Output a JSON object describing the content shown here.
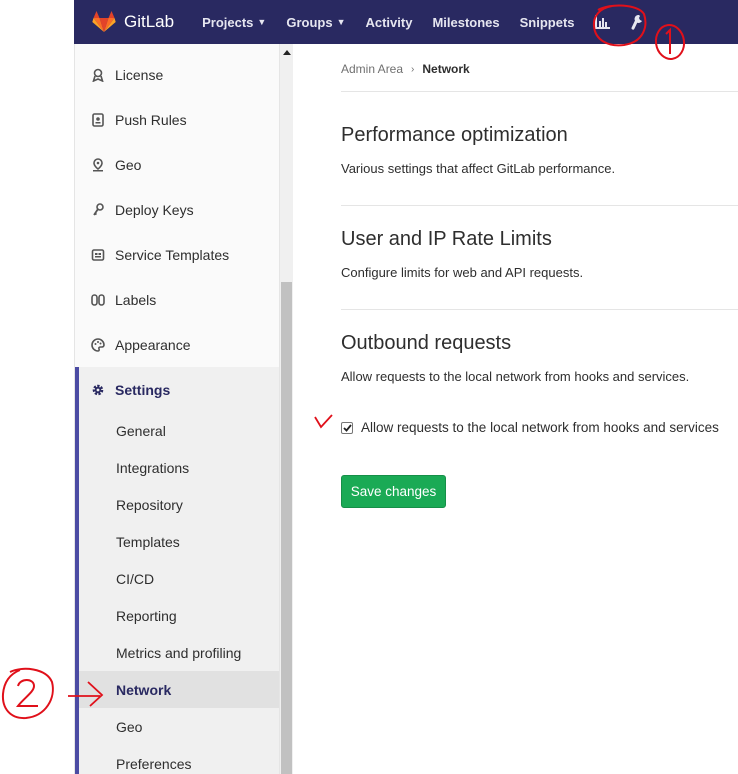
{
  "navbar": {
    "brand": "GitLab",
    "items": [
      {
        "label": "Projects",
        "has_caret": true
      },
      {
        "label": "Groups",
        "has_caret": true
      },
      {
        "label": "Activity",
        "has_caret": false
      },
      {
        "label": "Milestones",
        "has_caret": false
      },
      {
        "label": "Snippets",
        "has_caret": false
      }
    ],
    "icons": [
      "chart-icon",
      "wrench-icon"
    ],
    "color": "#292961"
  },
  "sidebar": {
    "items": [
      {
        "label": "License",
        "icon": "license-icon"
      },
      {
        "label": "Push Rules",
        "icon": "push-rules-icon"
      },
      {
        "label": "Geo",
        "icon": "location-icon"
      },
      {
        "label": "Deploy Keys",
        "icon": "key-icon"
      },
      {
        "label": "Service Templates",
        "icon": "template-icon"
      },
      {
        "label": "Labels",
        "icon": "label-icon"
      },
      {
        "label": "Appearance",
        "icon": "palette-icon"
      }
    ],
    "settings": {
      "label": "Settings",
      "icon": "gear-icon",
      "subitems": [
        "General",
        "Integrations",
        "Repository",
        "Templates",
        "CI/CD",
        "Reporting",
        "Metrics and profiling",
        "Network",
        "Geo",
        "Preferences"
      ],
      "active": "Network"
    }
  },
  "breadcrumb": {
    "parent": "Admin Area",
    "current": "Network"
  },
  "sections": [
    {
      "title": "Performance optimization",
      "description": "Various settings that affect GitLab performance."
    },
    {
      "title": "User and IP Rate Limits",
      "description": "Configure limits for web and API requests."
    },
    {
      "title": "Outbound requests",
      "description": "Allow requests to the local network from hooks and services."
    }
  ],
  "outbound": {
    "checkbox_label": "Allow requests to the local network from hooks and services",
    "checked": true
  },
  "save_button": {
    "label": "Save changes",
    "color": "#1aaa55"
  },
  "annotations": {
    "color": "#e0101a",
    "marks": [
      "1",
      "2"
    ]
  }
}
